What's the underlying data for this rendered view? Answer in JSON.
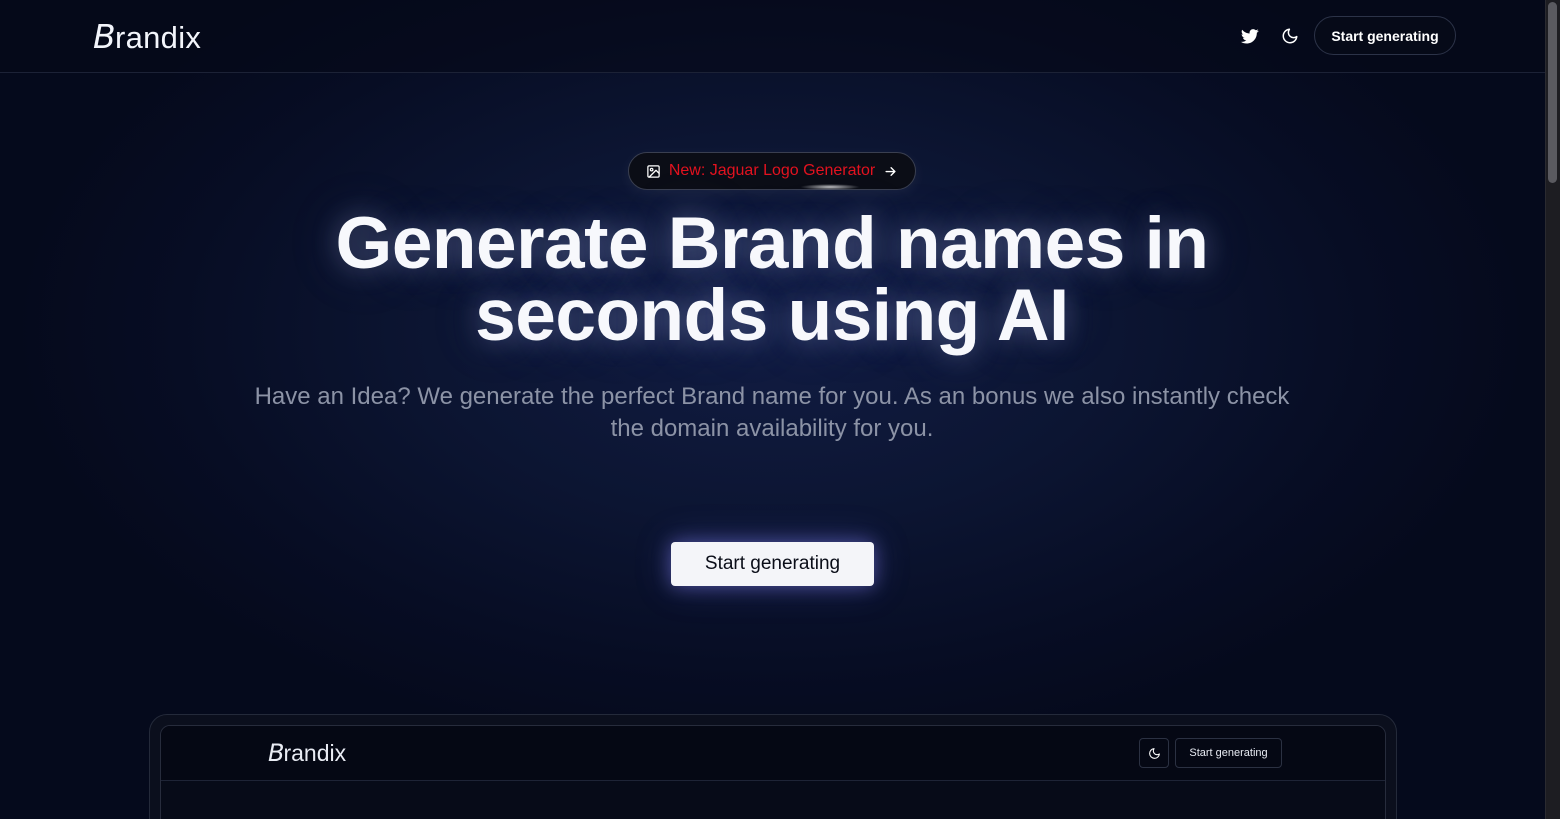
{
  "header": {
    "logo_initial": "B",
    "logo_rest": "randix",
    "twitter_icon": "twitter-icon",
    "theme_icon": "moon-icon",
    "cta_label": "Start generating"
  },
  "badge": {
    "icon": "image-icon",
    "text": "New: Jaguar Logo Generator",
    "arrow_icon": "arrow-right-icon",
    "color": "#e3121f"
  },
  "hero": {
    "title_line1": "Generate Brand names in",
    "title_line2": "seconds using AI",
    "subtitle": "Have an Idea? We generate the perfect Brand name for you. As an bonus we also instantly check the domain availability for you.",
    "cta_label": "Start generating"
  },
  "preview": {
    "logo_initial": "B",
    "logo_rest": "randix",
    "theme_icon": "moon-icon",
    "cta_label": "Start generating"
  },
  "colors": {
    "background": "#050a1c",
    "accent_glow": "#8c8cff",
    "badge_text": "#e3121f"
  }
}
